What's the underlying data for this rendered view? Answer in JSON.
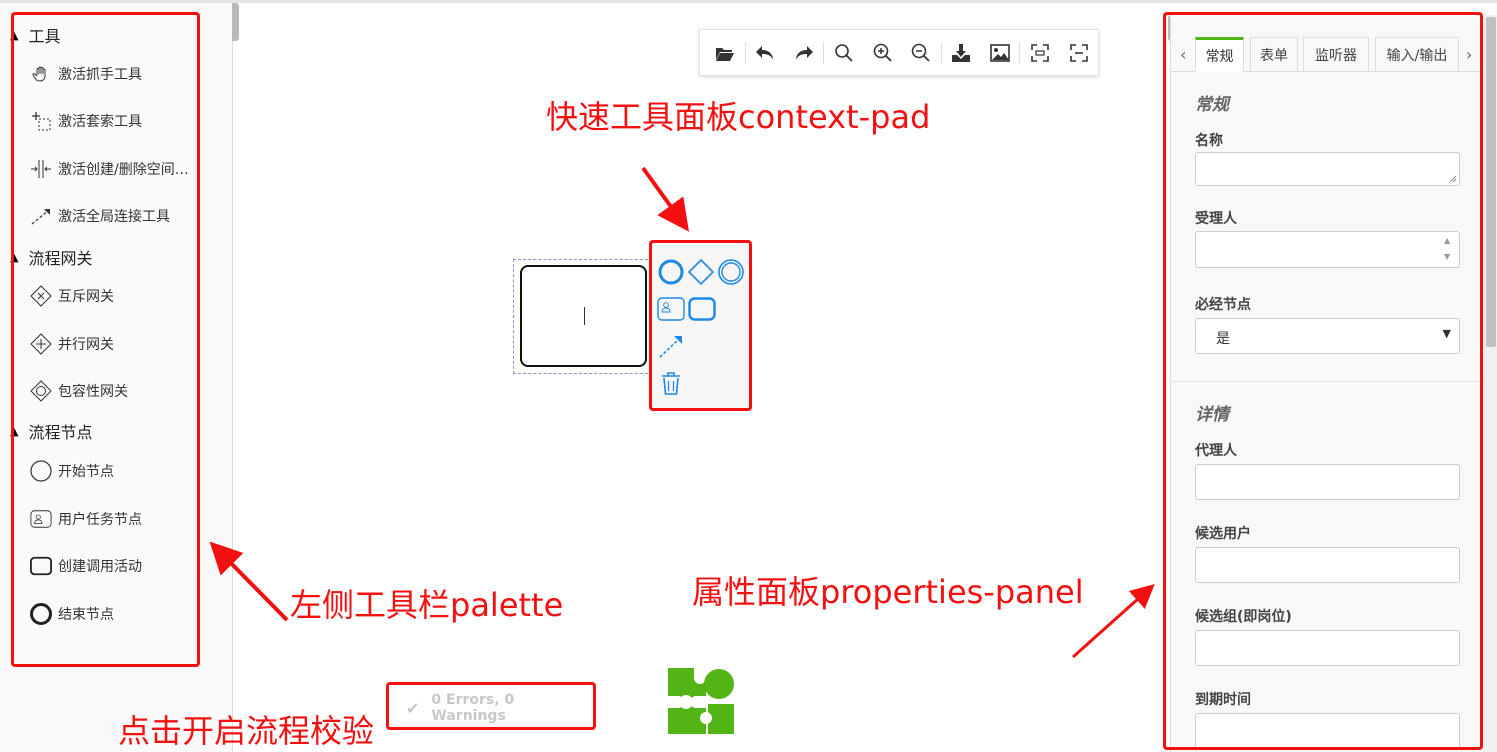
{
  "palette": {
    "groups": [
      {
        "title": "工具",
        "items": [
          {
            "label": "激活抓手工具",
            "icon": "hand-icon"
          },
          {
            "label": "激活套索工具",
            "icon": "lasso-icon"
          },
          {
            "label": "激活创建/删除空间工具",
            "icon": "space-tool-icon"
          },
          {
            "label": "激活全局连接工具",
            "icon": "global-connect-icon"
          }
        ]
      },
      {
        "title": "流程网关",
        "items": [
          {
            "label": "互斥网关",
            "icon": "exclusive-gateway-icon"
          },
          {
            "label": "并行网关",
            "icon": "parallel-gateway-icon"
          },
          {
            "label": "包容性网关",
            "icon": "inclusive-gateway-icon"
          }
        ]
      },
      {
        "title": "流程节点",
        "items": [
          {
            "label": "开始节点",
            "icon": "start-event-icon"
          },
          {
            "label": "用户任务节点",
            "icon": "user-task-icon"
          },
          {
            "label": "创建调用活动",
            "icon": "call-activity-icon"
          },
          {
            "label": "结束节点",
            "icon": "end-event-icon"
          }
        ]
      }
    ]
  },
  "toolbar": {
    "buttons": [
      "open-file",
      "undo",
      "redo",
      "search",
      "zoom-in",
      "zoom-out",
      "download",
      "image",
      "fit-view",
      "reset-view"
    ]
  },
  "status": {
    "text": "0 Errors, 0 Warnings"
  },
  "annotations": {
    "context_pad": "快速工具面板context-pad",
    "palette": "左侧工具栏palette",
    "properties": "属性面板properties-panel",
    "validation": "点击开启流程校验"
  },
  "properties": {
    "tabs": [
      {
        "label": "常规",
        "active": true
      },
      {
        "label": "表单",
        "active": false
      },
      {
        "label": "监听器",
        "active": false
      },
      {
        "label": "输入/输出",
        "active": false
      }
    ],
    "general": {
      "title": "常规",
      "name_label": "名称",
      "assignee_label": "受理人",
      "required_label": "必经节点",
      "required_value": "是"
    },
    "details": {
      "title": "详情",
      "delegate_label": "代理人",
      "candidate_users_label": "候选用户",
      "candidate_groups_label": "候选组(即岗位)",
      "due_date_label": "到期时间"
    }
  },
  "colors": {
    "accent": "#52b415",
    "annotation": "#f31010",
    "context_pad_icon": "#1e88e5"
  }
}
